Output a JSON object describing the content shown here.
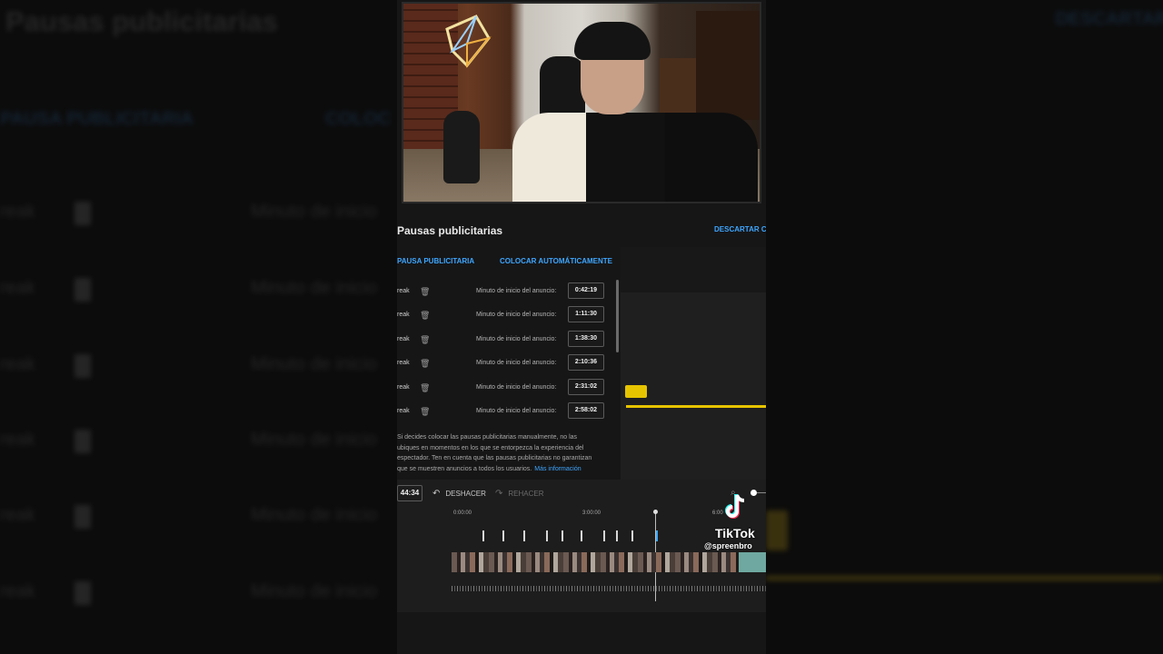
{
  "background": {
    "title": "Pausas publicitarias",
    "discard": "DESCARTAR CA",
    "tab_manual": "PAUSA PUBLICITARIA",
    "tab_auto": "COLOC",
    "row_name": "reak",
    "row_label": "Minuto de inicio"
  },
  "panel": {
    "title": "Pausas publicitarias",
    "discard": "DESCARTAR CA",
    "tab_manual": "PAUSA PUBLICITARIA",
    "tab_auto": "COLOCAR AUTOMÁTICAMENTE"
  },
  "breaks": [
    {
      "name": "reak",
      "label": "Minuto de inicio del anuncio:",
      "time": "0:42:19"
    },
    {
      "name": "reak",
      "label": "Minuto de inicio del anuncio:",
      "time": "1:11:30"
    },
    {
      "name": "reak",
      "label": "Minuto de inicio del anuncio:",
      "time": "1:38:30"
    },
    {
      "name": "reak",
      "label": "Minuto de inicio del anuncio:",
      "time": "2:10:36"
    },
    {
      "name": "reak",
      "label": "Minuto de inicio del anuncio:",
      "time": "2:31:02"
    },
    {
      "name": "reak",
      "label": "Minuto de inicio del anuncio:",
      "time": "2:58:02"
    }
  ],
  "info": {
    "line1": "Si decides colocar las pausas publicitarias manualmente, no las",
    "line2": "ubiques en momentos en los que se entorpezca la experiencia del",
    "line3": "espectador. Ten en cuenta que las pausas publicitarias no garantizan",
    "line4": "que se muestren anuncios a todos los usuarios.",
    "more": "Más información"
  },
  "timeline": {
    "current_time": "44:34",
    "undo": "DESHACER",
    "redo": "REHACER",
    "ticks": [
      "0:00:00",
      "3:00:00",
      "6:00"
    ]
  },
  "watermark": {
    "brand": "TikTok",
    "user": "@spreenbro"
  },
  "colors": {
    "accent": "#3ea6ff",
    "marker_yellow": "#e6c400"
  }
}
